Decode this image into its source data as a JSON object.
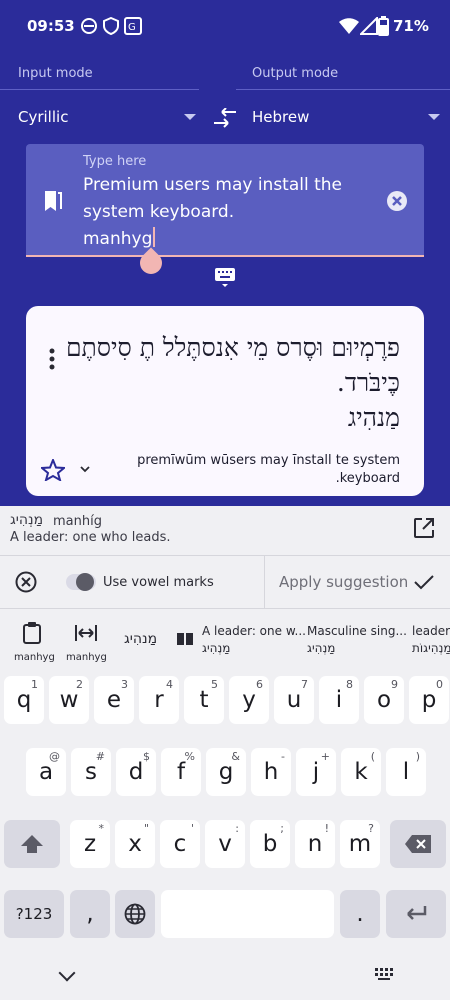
{
  "status": {
    "time": "09:53",
    "battery": "71%"
  },
  "modes": {
    "input_label": "Input mode",
    "input_value": "Cyrillic",
    "output_label": "Output mode",
    "output_value": "Hebrew"
  },
  "input": {
    "placeholder": "Type here",
    "text": "Premium users may install the\nsystem keyboard.\nmanhyg"
  },
  "output": {
    "hebrew": "פרֶמְיוּם וּסֶרס מֵי אִנסתֶּלל תֶ סִיסתֶם כֶּיבֹּרד.\nמַנהִיג",
    "translit": "premīwūm wūsers may īnstall te system .keyboard"
  },
  "dictionary": {
    "hebrew": "מַנְהִיג",
    "translit": "manhíg",
    "definition": "A leader: one who leads."
  },
  "toolbar": {
    "vowel_label": "Use vowel marks",
    "apply_label": "Apply suggestion"
  },
  "suggestions": {
    "chip1": "manhyg",
    "chip2": "manhyg",
    "word": "מַנהִיג",
    "def_top": "A leader: one w...",
    "def_bottom": "מַנְהִיג",
    "masc_top": "Masculine sing...",
    "masc_bottom": "מַנְהִיג",
    "plural_top": "leaders",
    "plural_bottom": "מַנְהִיגוֹת"
  },
  "keyboard": {
    "row1": [
      [
        "q",
        "1"
      ],
      [
        "w",
        "2"
      ],
      [
        "e",
        "3"
      ],
      [
        "r",
        "4"
      ],
      [
        "t",
        "5"
      ],
      [
        "y",
        "6"
      ],
      [
        "u",
        "7"
      ],
      [
        "i",
        "8"
      ],
      [
        "o",
        "9"
      ],
      [
        "p",
        "0"
      ]
    ],
    "row2": [
      [
        "a",
        "@"
      ],
      [
        "s",
        "#"
      ],
      [
        "d",
        "$"
      ],
      [
        "f",
        "%"
      ],
      [
        "g",
        "&"
      ],
      [
        "h",
        "-"
      ],
      [
        "j",
        "+"
      ],
      [
        "k",
        "("
      ],
      [
        "l",
        ")"
      ]
    ],
    "row3": [
      [
        "z",
        "*"
      ],
      [
        "x",
        "\""
      ],
      [
        "c",
        "'"
      ],
      [
        "v",
        ":"
      ],
      [
        "b",
        ";"
      ],
      [
        "n",
        "!"
      ],
      [
        "m",
        "?"
      ]
    ],
    "sym_label": "?123",
    "comma": ",",
    "period": "."
  },
  "colors": {
    "header_bg": "#2b2c9a",
    "input_bg": "#5a5ec0",
    "accent_pink": "#f2b6b3",
    "card_bg": "#fbf8ff",
    "keyboard_bg": "#f0f0f3"
  }
}
